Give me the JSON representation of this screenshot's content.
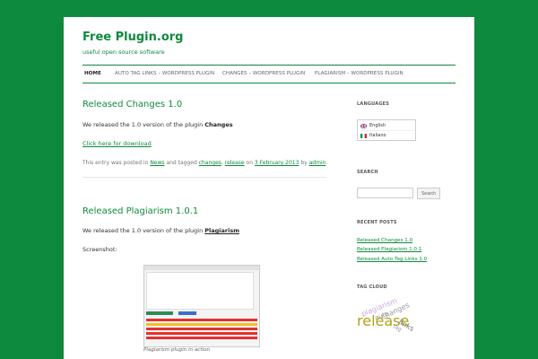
{
  "header": {
    "site_title": "Free Plugin.org",
    "site_description": "useful open source software"
  },
  "nav": {
    "items": [
      {
        "label": "HOME",
        "active": true
      },
      {
        "label": "AUTO TAG LINKS – WORDPRESS PLUGIN"
      },
      {
        "label": "CHANGES – WORDPRESS PLUGIN"
      },
      {
        "label": "PLAGIARISM – WORDPRESS PLUGIN"
      }
    ]
  },
  "posts": [
    {
      "title": "Released Changes 1.0",
      "text_before": "We released the 1.0 version of the plugin ",
      "plugin_name": "Changes",
      "download_link": "Click here for download",
      "meta": {
        "prefix": "This entry was posted in ",
        "category": "News",
        "tagged": " and tagged ",
        "tag1": "changes",
        "comma": ", ",
        "tag2": "release",
        "on": " on ",
        "date": "3 February 2013",
        "by": " by ",
        "author": "admin",
        "end": "."
      }
    },
    {
      "title": "Released Plagiarism 1.0.1",
      "text_before": "We released the 1.0 version of the plugin ",
      "plugin_name": "Plagiarism",
      "screenshot_label": "Screenshot:",
      "caption": "Plagiarism plugin in action"
    }
  ],
  "sidebar": {
    "languages_title": "LANGUAGES",
    "languages": [
      {
        "label": "English",
        "flag": "uk-flag-icon"
      },
      {
        "label": "Italiano",
        "flag": "italy-flag-icon"
      }
    ],
    "search_title": "SEARCH",
    "search_button": "Search",
    "search_placeholder": "",
    "recent_posts_title": "RECENT POSTS",
    "recent_posts": [
      "Released Changes 1.0",
      "Released Plagiarism 1.0.1",
      "Released Auto Tag Links 1.0"
    ],
    "tag_cloud_title": "TAG CLOUD",
    "tags": [
      "changes",
      "plagiarism",
      "auto",
      "release",
      "links",
      "tag"
    ]
  },
  "colors": {
    "accent": "#0e8a3e",
    "tag_release": "#b0a21a"
  }
}
